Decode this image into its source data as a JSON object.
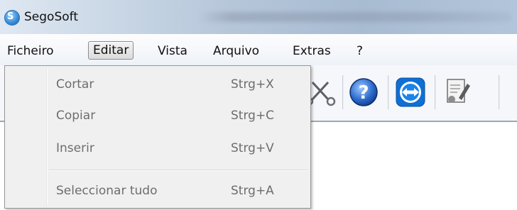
{
  "window": {
    "title": "SegoSoft"
  },
  "menubar": {
    "items": [
      {
        "label": "Ficheiro"
      },
      {
        "label": "Editar"
      },
      {
        "label": "Vista"
      },
      {
        "label": "Arquivo"
      },
      {
        "label": "Extras"
      },
      {
        "label": "?"
      }
    ],
    "active": "Editar"
  },
  "edit_menu": {
    "items": [
      {
        "label": "Cortar",
        "shortcut": "Strg+X",
        "enabled": false
      },
      {
        "label": "Copiar",
        "shortcut": "Strg+C",
        "enabled": false
      },
      {
        "label": "Inserir",
        "shortcut": "Strg+V",
        "enabled": false
      },
      {
        "label": "Seleccionar tudo",
        "shortcut": "Strg+A",
        "enabled": false
      }
    ]
  },
  "toolbar": {
    "icons": [
      "scissors-icon",
      "help-icon",
      "teamviewer-icon",
      "certificate-icon"
    ]
  },
  "colors": {
    "titlebar": "#b6c6d9",
    "disabled_text": "#6d6d6d",
    "menu_bg": "#f0f0f0"
  }
}
